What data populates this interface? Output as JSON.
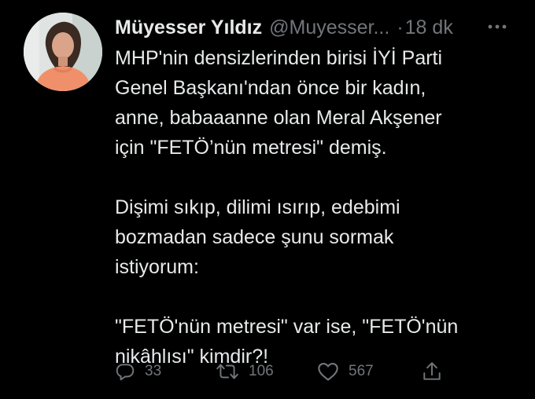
{
  "tweet": {
    "author": {
      "display_name": "Müyesser Yıldız",
      "handle": "@Muyesser...",
      "avatar_icon": "profile-photo"
    },
    "separator": "·",
    "timestamp": "18 dk",
    "more_icon": "ellipsis-icon",
    "paragraphs": [
      "MHP'nin densizlerinden birisi İYİ Parti\nGenel Başkanı'ndan önce bir kadın,\nanne, babaaanne olan Meral Akşener\niçin \"FETÖ’nün metresi\" demiş.",
      "Dişimi sıkıp, dilimi ısırıp, edebimi\nbozmadan sadece şunu sormak\nistiyorum:",
      "\"FETÖ'nün metresi\" var ise, \"FETÖ'nün\nnikâhlısı\" kimdir?!"
    ],
    "actions": {
      "reply": {
        "icon": "reply-icon",
        "count": "33"
      },
      "retweet": {
        "icon": "retweet-icon",
        "count": "106"
      },
      "like": {
        "icon": "heart-icon",
        "count": "567"
      },
      "share": {
        "icon": "share-icon"
      }
    }
  },
  "colors": {
    "background": "#000000",
    "primary_text": "#e7e9ea",
    "secondary_text": "#71767b"
  }
}
